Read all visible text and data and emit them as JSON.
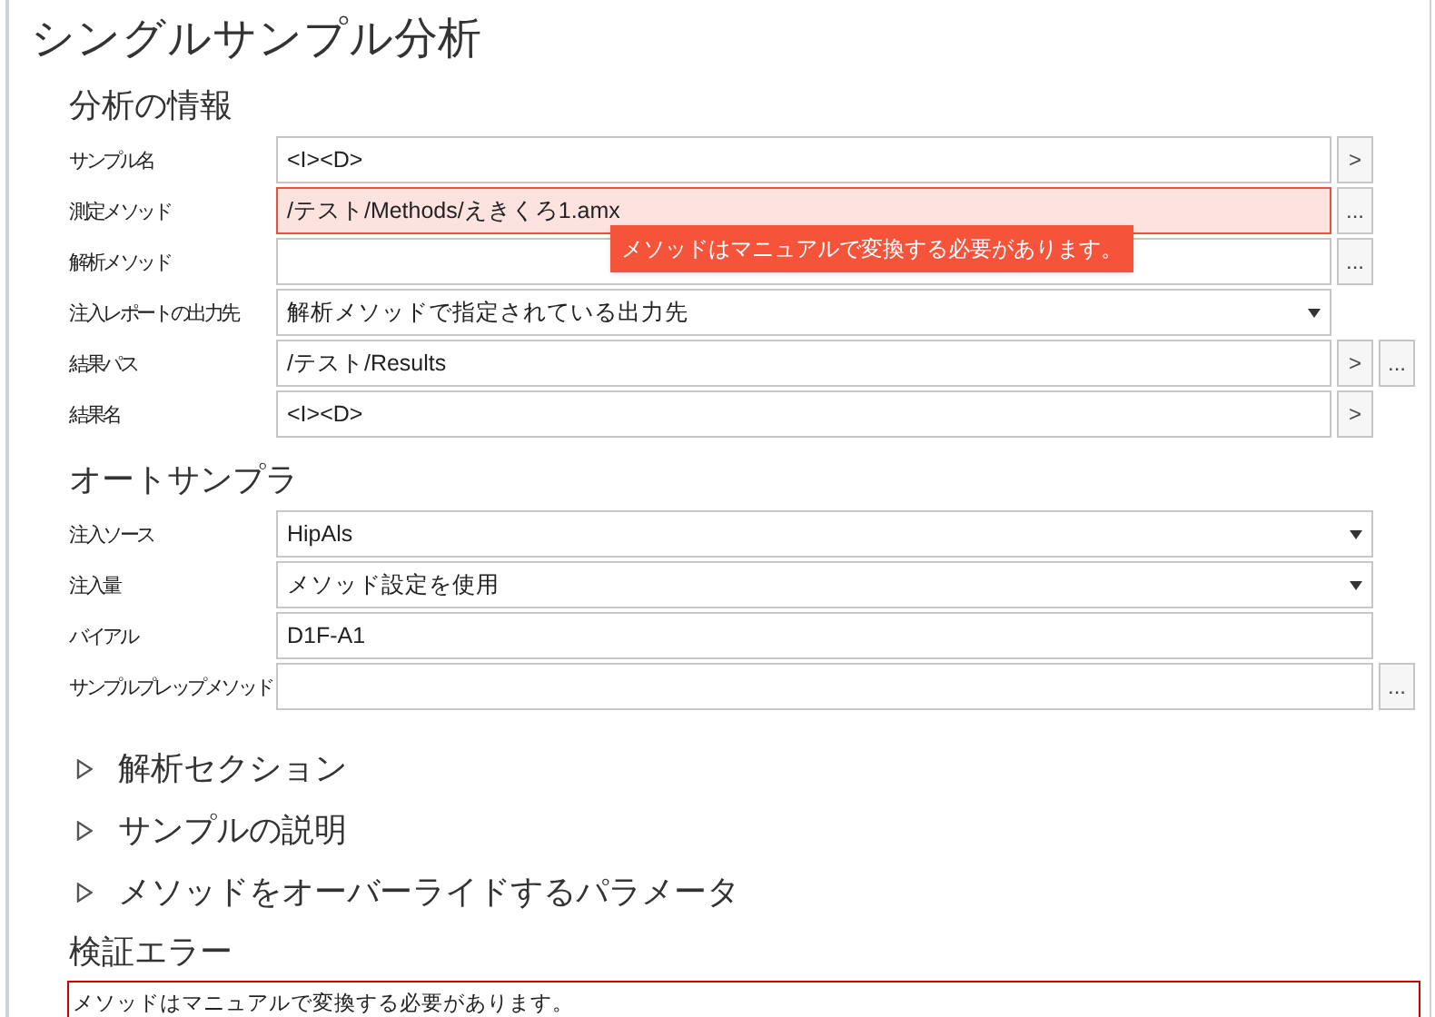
{
  "title": "シングルサンプル分析",
  "sections": [
    {
      "kind": "fields",
      "heading": "分析の情報",
      "rows": [
        {
          "label": "サンプル名",
          "kind": "text",
          "value": "<I><D>",
          "error": false,
          "buttons": [
            ">"
          ]
        },
        {
          "label": "測定メソッド",
          "kind": "text",
          "value": "/テスト/Methods/えきくろ1.amx",
          "error": true,
          "tooltip": "メソッドはマニュアルで変換する必要があります。",
          "buttons": [
            "..."
          ]
        },
        {
          "label": "解析メソッド",
          "kind": "text",
          "value": "",
          "error": false,
          "buttons": [
            "..."
          ]
        },
        {
          "label": "注入レポートの出力先",
          "kind": "dropdown",
          "value": "解析メソッドで指定されている出力先",
          "error": false,
          "buttons": []
        },
        {
          "label": "結果パス",
          "kind": "text",
          "value": "/テスト/Results",
          "error": false,
          "buttons": [
            ">",
            "..."
          ]
        },
        {
          "label": "結果名",
          "kind": "text",
          "value": "<I><D>",
          "error": false,
          "buttons": [
            ">"
          ]
        }
      ]
    },
    {
      "kind": "fields",
      "heading": "オートサンプラ",
      "rows": [
        {
          "label": "注入ソース",
          "kind": "dropdown",
          "value": "HipAls",
          "error": false,
          "buttons": []
        },
        {
          "label": "注入量",
          "kind": "dropdown",
          "value": "メソッド設定を使用",
          "error": false,
          "buttons": []
        },
        {
          "label": "バイアル",
          "kind": "text",
          "value": "D1F-A1",
          "error": false,
          "buttons": []
        },
        {
          "label": "サンプルプレップメソッド",
          "kind": "text",
          "value": "",
          "error": false,
          "buttons": [
            "..."
          ]
        }
      ]
    },
    {
      "kind": "collapsible",
      "heading": "解析セクション",
      "expanded": false
    },
    {
      "kind": "collapsible",
      "heading": "サンプルの説明",
      "expanded": false
    },
    {
      "kind": "collapsible",
      "heading": "メソッドをオーバーライドするパラメータ",
      "expanded": false
    },
    {
      "kind": "errors",
      "heading": "検証エラー",
      "messages": [
        "メソッドはマニュアルで変換する必要があります。"
      ]
    }
  ]
}
